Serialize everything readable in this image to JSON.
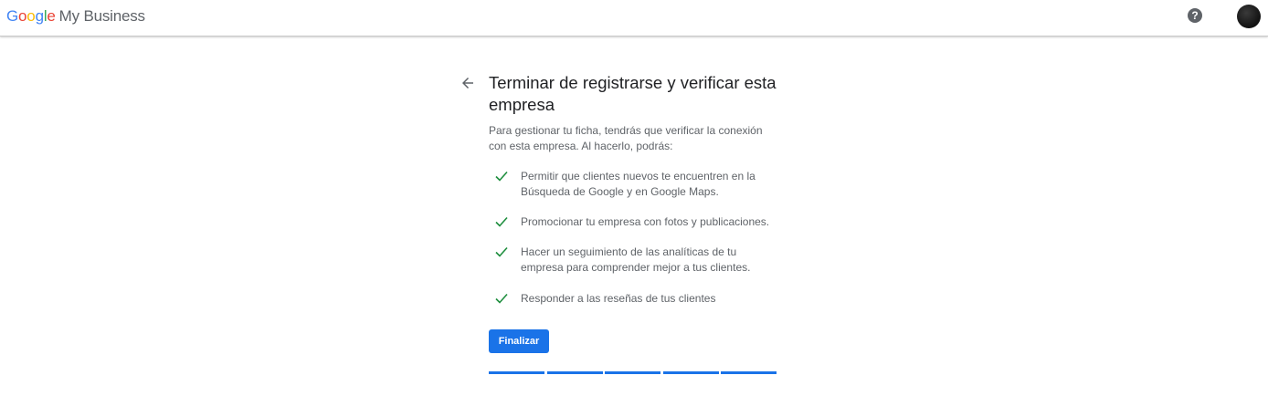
{
  "header": {
    "logo_letters": [
      "G",
      "o",
      "o",
      "g",
      "l",
      "e"
    ],
    "product_name": "My Business",
    "help_glyph": "?",
    "help_icon": "help-icon",
    "avatar_icon": "account-avatar"
  },
  "main": {
    "back_icon": "arrow-back-icon",
    "title": "Terminar de registrarse y verificar esta empresa",
    "description": "Para gestionar tu ficha, tendrás que verificar la conexión con esta empresa. Al hacerlo, podrás:",
    "benefits": [
      {
        "icon": "check-icon",
        "text": "Permitir que clientes nuevos te encuentren en la Búsqueda de Google y en Google Maps."
      },
      {
        "icon": "check-icon",
        "text": "Promocionar tu empresa con fotos y publicaciones."
      },
      {
        "icon": "check-icon",
        "text": "Hacer un seguimiento de las analíticas de tu empresa para comprender mejor a tus clientes."
      },
      {
        "icon": "check-icon",
        "text": "Responder a las reseñas de tus clientes"
      }
    ],
    "finish_label": "Finalizar",
    "progress": {
      "total_steps": 5,
      "completed_steps": 5
    }
  },
  "colors": {
    "accent": "#1a73e8",
    "check": "#1e8e3e",
    "text_primary": "#202124",
    "text_secondary": "#5f6368"
  }
}
